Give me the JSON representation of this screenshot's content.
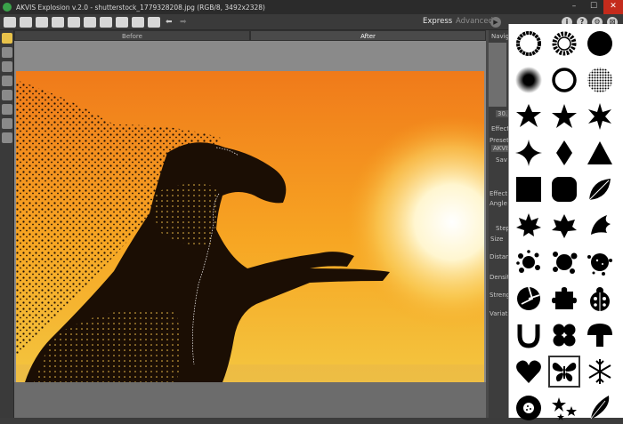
{
  "window": {
    "title": "AKVIS Explosion v.2.0 - shutterstock_1779328208.jpg (RGB/8, 3492x2328)",
    "minimize": "–",
    "maximize": "☐",
    "close": "✕"
  },
  "toolbar": {
    "mode_express": "Express",
    "mode_advanced": "Advanced",
    "run_symbol": "▶",
    "top_icons": [
      "i",
      "?",
      "⚙",
      "⊠"
    ],
    "undo_symbol": "⬅",
    "redo_symbol": "➡"
  },
  "tabs": {
    "before": "Before",
    "after": "After"
  },
  "right_panel": {
    "navigator": "Navig",
    "zoom": "30.",
    "effect": "Effect",
    "presets": "Presets",
    "preset_value": "AKVIS",
    "save": "Sav",
    "effect_b": "Effect B",
    "angle": "Angle",
    "step": "Step",
    "size": "Size",
    "distance": "Distanc",
    "density": "Density",
    "strength": "Strengt",
    "variation": "Variatio"
  },
  "shapes_popup": {
    "shapes": [
      "ring-rough",
      "gear",
      "circle-filled",
      "circle-soft",
      "ring",
      "halftone-circle",
      "star-6",
      "star-5",
      "star-8",
      "sparkle-4",
      "diamond",
      "triangle",
      "square",
      "rounded-square",
      "leaf",
      "maple-leaf-1",
      "maple-leaf-2",
      "maple-leaf-3",
      "splatter-1",
      "splatter-2",
      "splatter-3",
      "shard-circle",
      "puzzle-piece",
      "ladybug",
      "horseshoe",
      "four-leaf-clover",
      "mushroom",
      "heart",
      "butterfly",
      "snowflake",
      "sunflower",
      "stars-cluster",
      "feather"
    ],
    "selected": "butterfly"
  }
}
